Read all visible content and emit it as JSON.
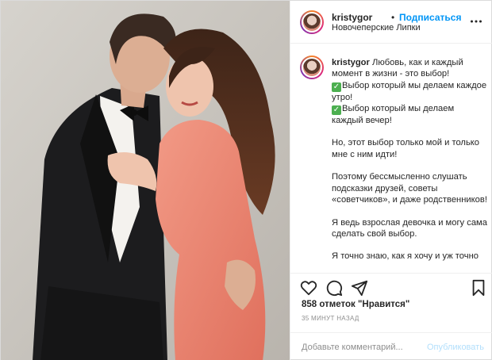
{
  "header": {
    "username": "kristygor",
    "separator": "•",
    "follow_label": "Подписаться",
    "location": "Новочеперские Липки",
    "more_icon": "more-horizontal-icon"
  },
  "caption": {
    "username": "kristygor",
    "lines": [
      "Любовь, как и каждый момент в жизни - это выбор!",
      "Выбор который мы делаем каждое утро!",
      "Выбор который мы делаем каждый вечер!",
      "Но, этот выбор только мой и только мне с ним идти!",
      "Поэтому бессмысленно слушать подсказки друзей, советы «советчиков», и даже родственников!",
      "Я ведь взрослая девочка и могу сама сделать свой выбор.",
      "Я точно знаю, как я хочу и уж точно"
    ],
    "check_icon": "check-mark-emoji"
  },
  "actions": {
    "like_icon": "heart-icon",
    "comment_icon": "comment-icon",
    "share_icon": "paper-plane-icon",
    "save_icon": "bookmark-icon",
    "likes_text": "858 отметок \"Нравится\"",
    "time_text": "35 МИНУТ НАЗАД"
  },
  "comment": {
    "placeholder": "Добавьте комментарий...",
    "publish_label": "Опубликовать"
  },
  "colors": {
    "accent": "#0095f6",
    "publish_disabled": "#b2dffc",
    "muted": "#8e8e8e",
    "border": "#efefef"
  }
}
